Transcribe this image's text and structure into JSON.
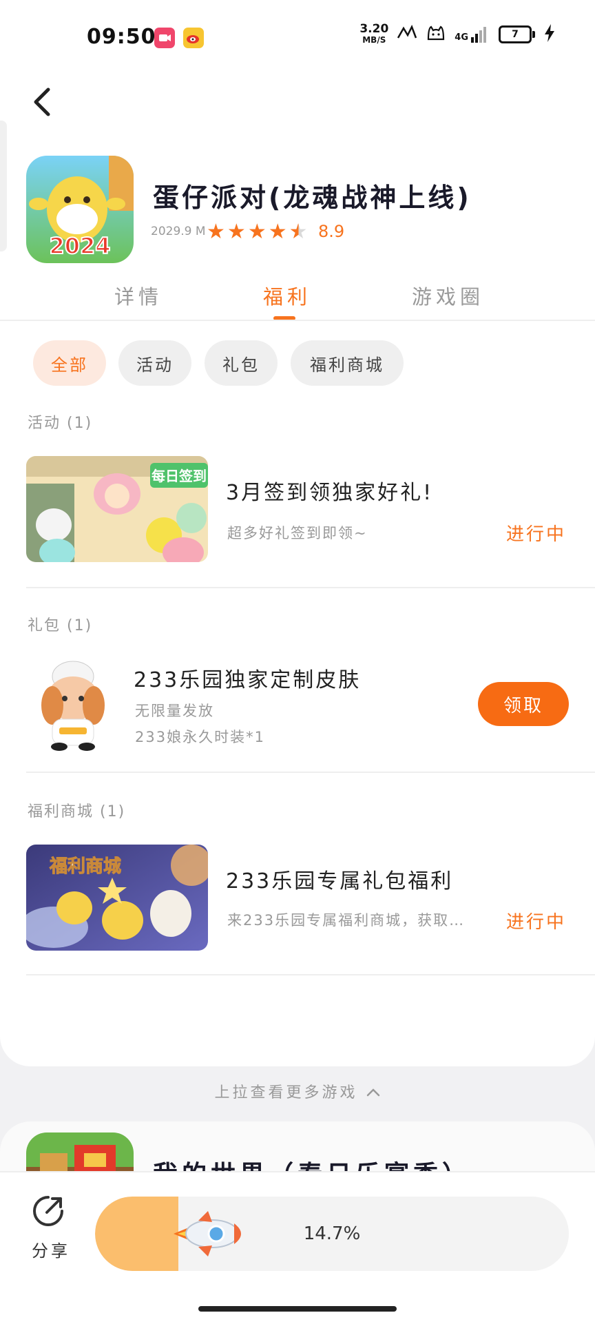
{
  "status_bar": {
    "time": "09:50",
    "net_speed_value": "3.20",
    "net_speed_unit": "MB/S",
    "network": "4G",
    "battery": "7"
  },
  "game": {
    "title": "蛋仔派对(龙魂战神上线)",
    "size": "2029.9 M",
    "rating": "8.9",
    "rating_value": 4.5,
    "icon_badge": "2024"
  },
  "tabs": [
    {
      "label": "详情"
    },
    {
      "label": "福利"
    },
    {
      "label": "游戏圈"
    }
  ],
  "chips": [
    {
      "label": "全部"
    },
    {
      "label": "活动"
    },
    {
      "label": "礼包"
    },
    {
      "label": "福利商城"
    }
  ],
  "sections": {
    "activity": {
      "header": "活动 (1)",
      "item": {
        "title": "3月签到领独家好礼!",
        "subtitle": "超多好礼签到即领~",
        "status": "进行中",
        "thumb_text": "每日签到"
      }
    },
    "gift": {
      "header": "礼包 (1)",
      "item": {
        "title": "233乐园独家定制皮肤",
        "line1": "无限量发放",
        "line2": "233娘永久时装*1",
        "button": "领取"
      }
    },
    "mall": {
      "header": "福利商城 (1)",
      "item": {
        "title": "233乐园专属礼包福利",
        "subtitle": "来233乐园专属福利商城，获取…",
        "status": "进行中",
        "thumb_text": "福利商城"
      }
    }
  },
  "more_hint": "上拉查看更多游戏",
  "next_game": {
    "title": "我的世界（春日乐宴季）"
  },
  "bottom": {
    "share_label": "分享",
    "progress_text": "14.7%",
    "progress_value": 0.147
  },
  "colors": {
    "accent": "#f7731e",
    "button": "#f76b13"
  }
}
